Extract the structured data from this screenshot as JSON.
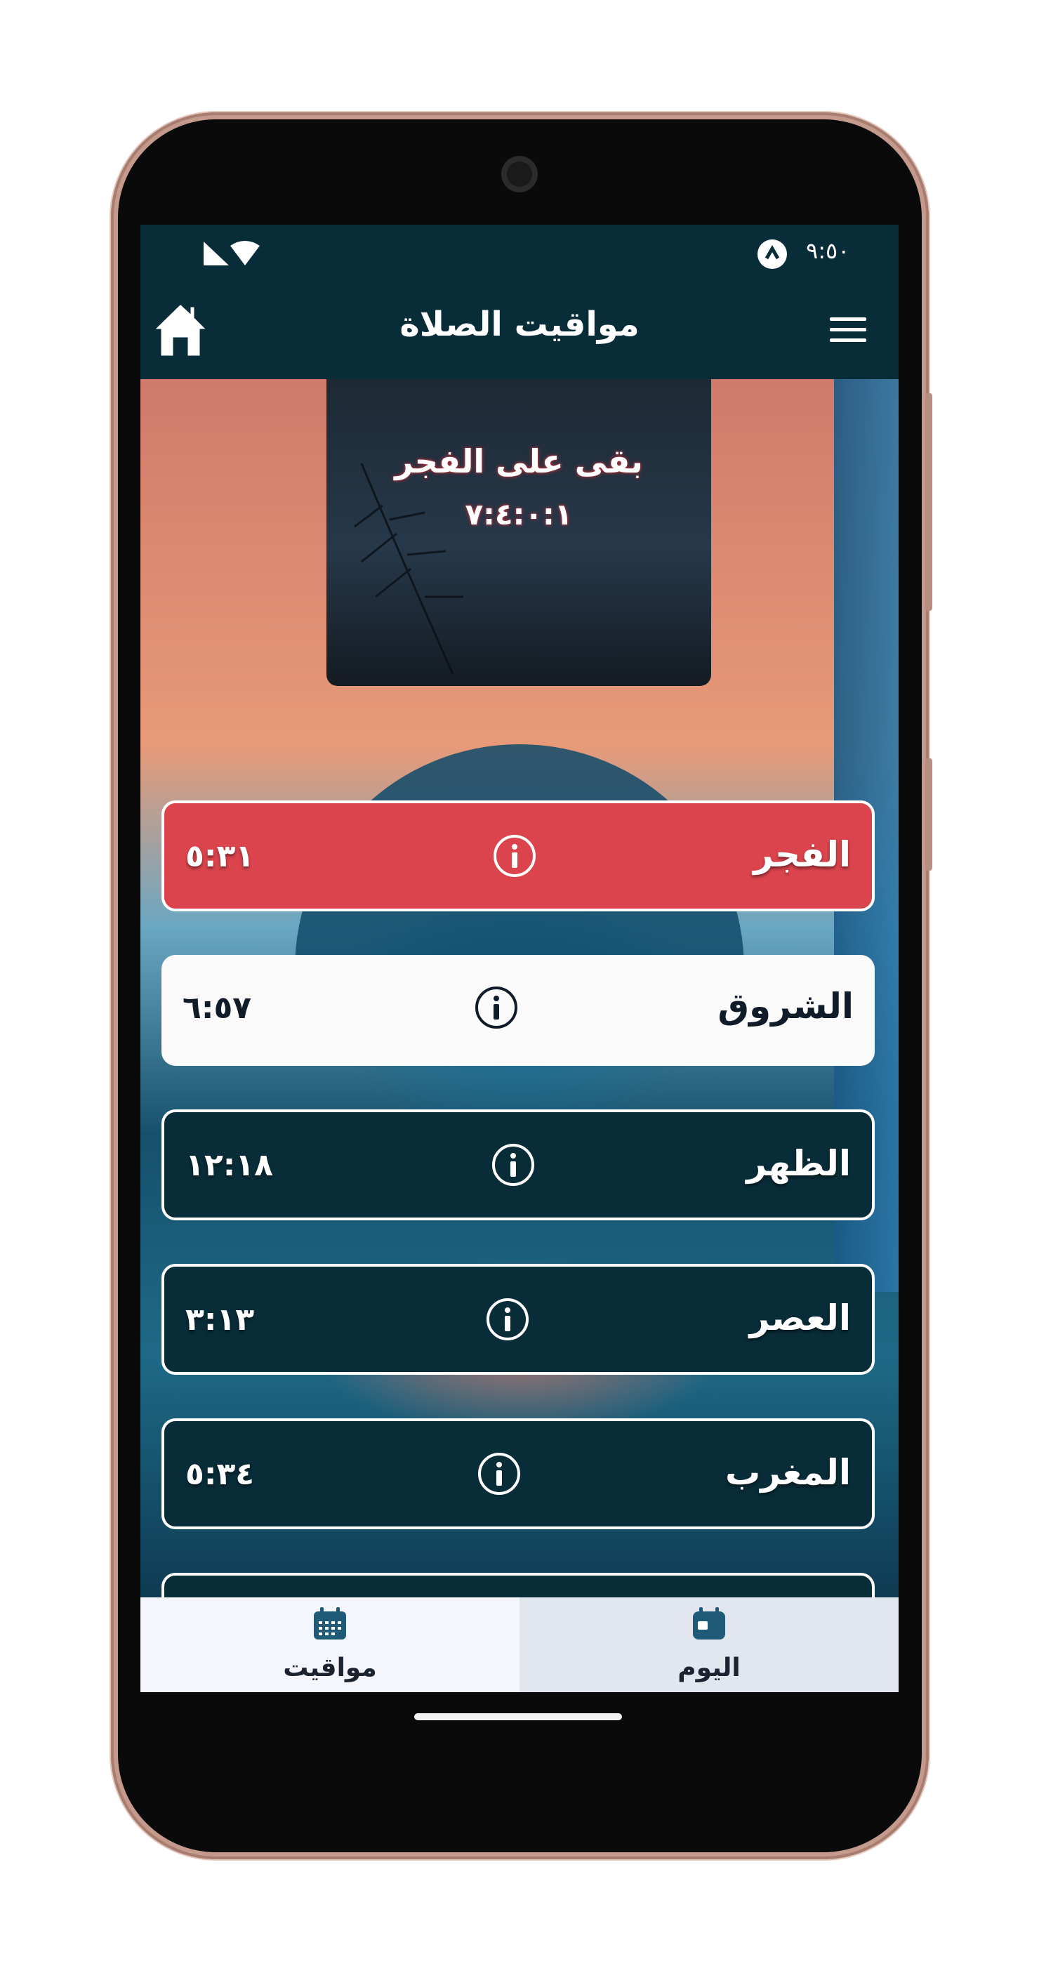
{
  "status_bar": {
    "time": "٩:٥٠"
  },
  "app_bar": {
    "title": "مواقيت الصلاة"
  },
  "countdown": {
    "label": "بقى على الفجر",
    "value": "٧:٤:٠:١"
  },
  "prayers": [
    {
      "name": "الفجر",
      "time": "٥:٣١",
      "state": "active"
    },
    {
      "name": "الشروق",
      "time": "٦:٥٧",
      "state": "light"
    },
    {
      "name": "الظهر",
      "time": "١٢:١٨",
      "state": "normal"
    },
    {
      "name": "العصر",
      "time": "٣:١٣",
      "state": "normal"
    },
    {
      "name": "المغرب",
      "time": "٥:٣٤",
      "state": "normal"
    }
  ],
  "bottom_nav": {
    "left_label": "مواقيت",
    "right_label": "اليوم"
  },
  "colors": {
    "active_row": "#db444c",
    "dark_row": "#082c38",
    "light_row": "#fbfbfb"
  },
  "icons": {
    "menu": "hamburger-icon",
    "home": "home-icon",
    "info": "info-icon",
    "calendar_month": "calendar-month-icon",
    "calendar_day": "calendar-day-icon"
  }
}
